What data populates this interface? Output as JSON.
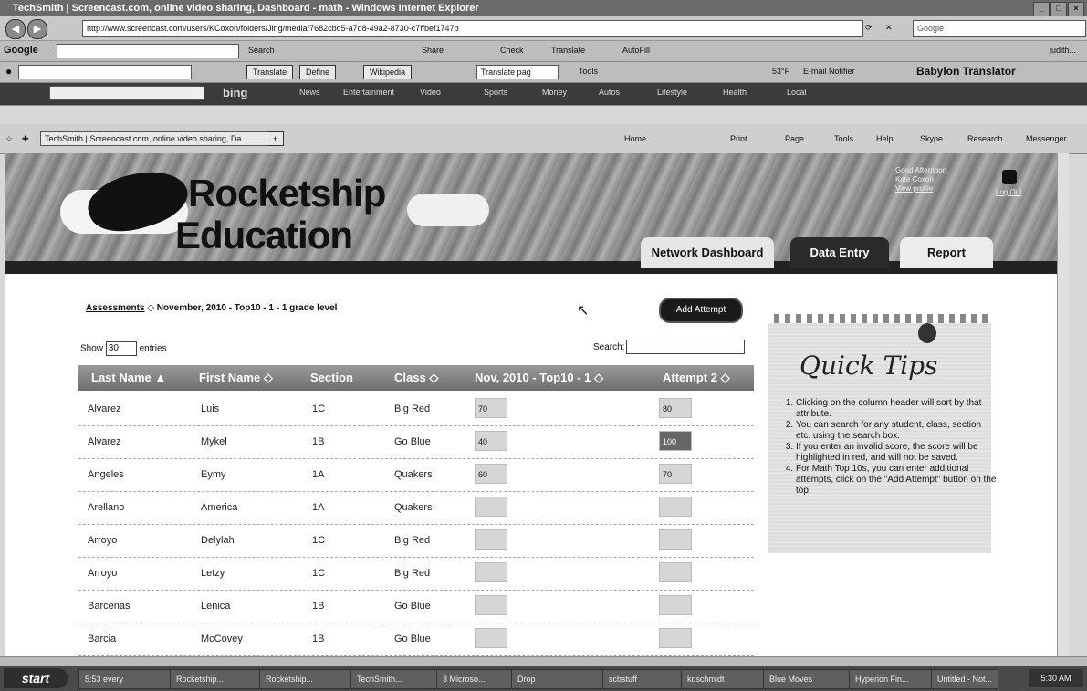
{
  "window": {
    "title": "TechSmith | Screencast.com, online video sharing, Dashboard - math - Windows Internet Explorer"
  },
  "address": {
    "url": "http://www.screencast.com/users/KCoxon/folders/Jing/media/7682cbd5-a7d8-49a2-8730-c7ffbef1747b",
    "search_placeholder": "Google"
  },
  "toolbar_google": {
    "label": "Google",
    "search_btn": "Search",
    "share": "Share",
    "check": "Check",
    "translate": "Translate",
    "autofill": "AutoFill",
    "user": "judith..."
  },
  "toolbar_babylon": {
    "translate_btn": "Translate",
    "define_btn": "Define",
    "wikipedia_btn": "Wikipedia",
    "translate_page": "Translate pag",
    "tools": "Tools",
    "weather": "53°F",
    "email": "E-mail Notifier",
    "brand": "Babylon Translator"
  },
  "toolbar_bing": {
    "logo": "bing",
    "items": [
      "News",
      "Entertainment",
      "Video",
      "Sports",
      "Money",
      "Autos",
      "Lifestyle",
      "Health",
      "Local"
    ]
  },
  "tabbar": {
    "tab_title": "TechSmith | Screencast.com, online video sharing, Da...",
    "home": "Home",
    "print": "Print",
    "page": "Page",
    "tools": "Tools",
    "help": "Help",
    "skype": "Skype",
    "research": "Research",
    "messenger": "Messenger"
  },
  "site": {
    "logo_line1": "Rocketship",
    "logo_line2": "Education",
    "user_greeting": "Good Afternoon,",
    "user_name": "Kate Coxon",
    "user_link": "View profile",
    "logout": "Log Out",
    "nav": {
      "network_dashboard": "Network Dashboard",
      "data_entry": "Data Entry",
      "report": "Report"
    }
  },
  "content": {
    "breadcrumb_link": "Assessments",
    "breadcrumb_sep": "◇",
    "breadcrumb_current": "November, 2010 - Top10 - 1 - 1 grade level",
    "add_attempt": "Add Attempt",
    "show_label": "Show",
    "show_value": "30",
    "entries_label": "entries",
    "search_label": "Search:",
    "columns": [
      "Last Name",
      "First Name",
      "Section",
      "Class",
      "Nov, 2010 - Top10 - 1",
      "Attempt 2"
    ],
    "rows": [
      {
        "last": "Alvarez",
        "first": "Luis",
        "section": "1C",
        "class": "Big Red",
        "score1": "70",
        "score2": "80",
        "highlight": false
      },
      {
        "last": "Alvarez",
        "first": "Mykel",
        "section": "1B",
        "class": "Go Blue",
        "score1": "40",
        "score2": "100",
        "highlight": true
      },
      {
        "last": "Angeles",
        "first": "Eymy",
        "section": "1A",
        "class": "Quakers",
        "score1": "60",
        "score2": "70",
        "highlight": false
      },
      {
        "last": "Arellano",
        "first": "America",
        "section": "1A",
        "class": "Quakers",
        "score1": "",
        "score2": "",
        "highlight": false
      },
      {
        "last": "Arroyo",
        "first": "Delylah",
        "section": "1C",
        "class": "Big Red",
        "score1": "",
        "score2": "",
        "highlight": false
      },
      {
        "last": "Arroyo",
        "first": "Letzy",
        "section": "1C",
        "class": "Big Red",
        "score1": "",
        "score2": "",
        "highlight": false
      },
      {
        "last": "Barcenas",
        "first": "Lenica",
        "section": "1B",
        "class": "Go Blue",
        "score1": "",
        "score2": "",
        "highlight": false
      },
      {
        "last": "Barcia",
        "first": "McCovey",
        "section": "1B",
        "class": "Go Blue",
        "score1": "",
        "score2": "",
        "highlight": false
      }
    ]
  },
  "tips": {
    "title": "Quick Tips",
    "items": [
      "Clicking on the column header will sort by that attribute.",
      "You can search for any student, class, section etc. using the search box.",
      "If you enter an invalid score, the score will be highlighted in red, and will not be saved.",
      "For Math Top 10s, you can enter additional attempts, click on the \"Add Attempt\" button on the top."
    ]
  },
  "taskbar": {
    "start": "start",
    "tasks": [
      "5:53 every",
      "Rocketship...",
      "Rocketship...",
      "TechSmith...",
      "3 Microso...",
      "Drop",
      "scbstuff",
      "kdschmidt",
      "Blue Moves",
      "Hyperion Fin...",
      "Untitled - Not..."
    ],
    "clock": "5:30 AM"
  }
}
